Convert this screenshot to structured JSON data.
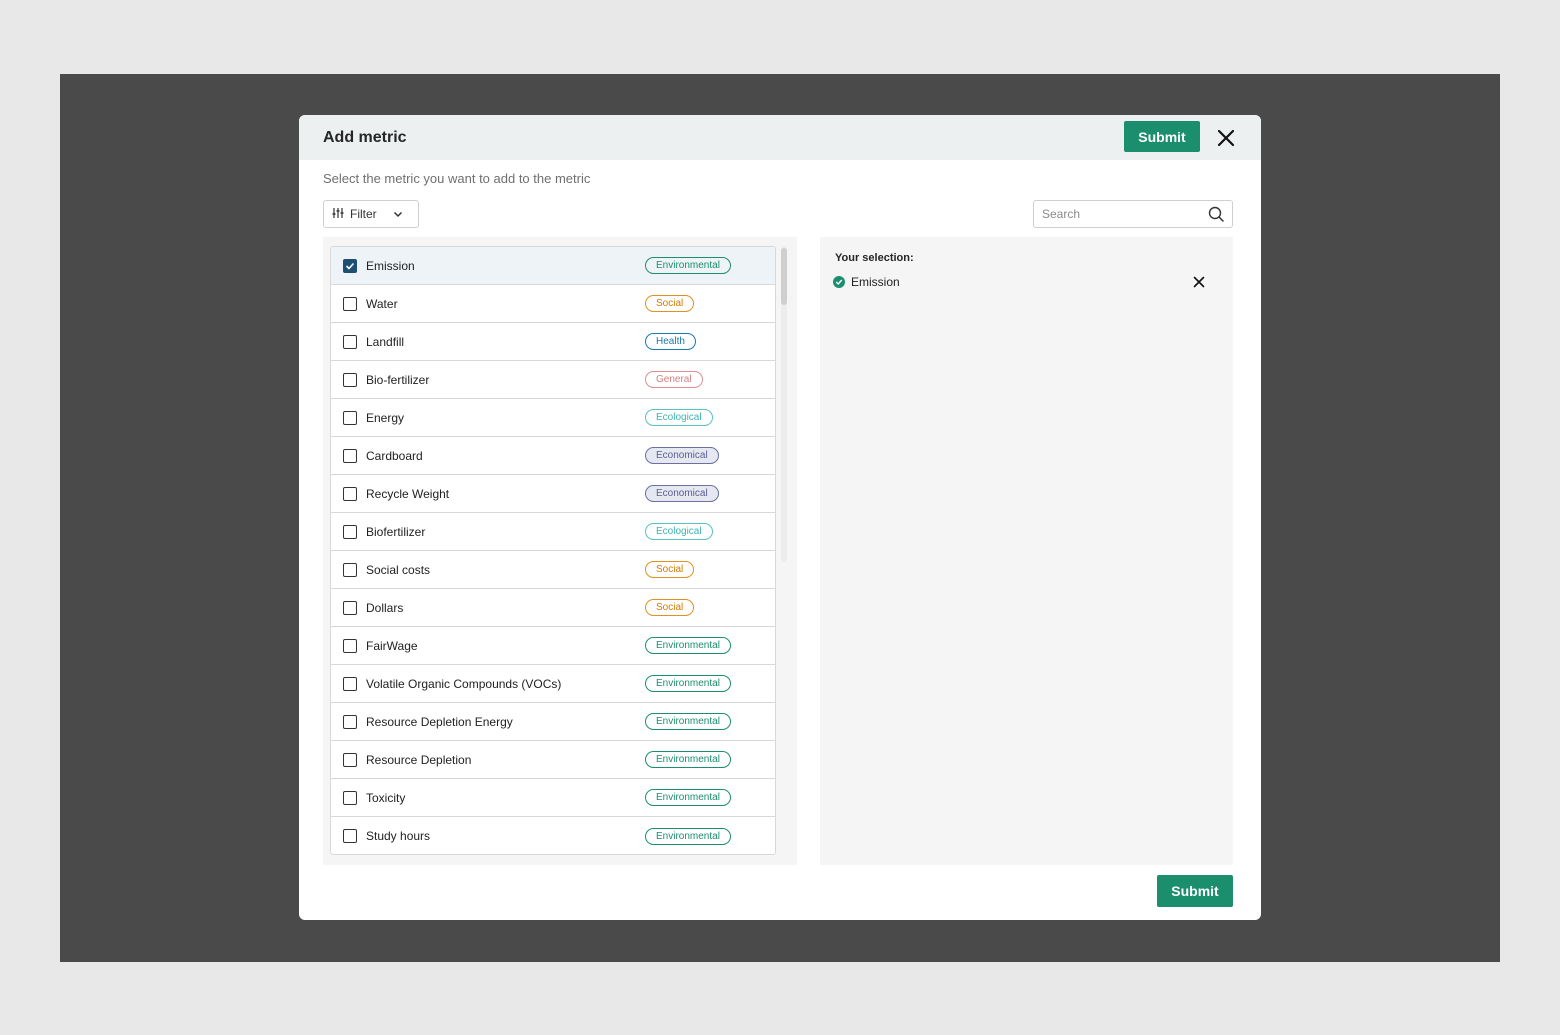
{
  "modal": {
    "title": "Add metric",
    "header_submit_label": "Submit",
    "subtitle": "Select the metric you want to add to the metric",
    "footer_submit_label": "Submit"
  },
  "filter": {
    "label": "Filter"
  },
  "search": {
    "placeholder": "Search",
    "value": ""
  },
  "metrics": [
    {
      "label": "Emission",
      "category": "Environmental",
      "checked": true
    },
    {
      "label": "Water",
      "category": "Social",
      "checked": false
    },
    {
      "label": "Landfill",
      "category": "Health",
      "checked": false
    },
    {
      "label": "Bio-fertilizer",
      "category": "General",
      "checked": false
    },
    {
      "label": "Energy",
      "category": "Ecological",
      "checked": false
    },
    {
      "label": "Cardboard",
      "category": "Economical",
      "checked": false
    },
    {
      "label": "Recycle Weight",
      "category": "Economical",
      "checked": false
    },
    {
      "label": "Biofertilizer",
      "category": "Ecological",
      "checked": false
    },
    {
      "label": "Social costs",
      "category": "Social",
      "checked": false
    },
    {
      "label": "Dollars",
      "category": "Social",
      "checked": false
    },
    {
      "label": "FairWage",
      "category": "Environmental",
      "checked": false
    },
    {
      "label": "Volatile Organic Compounds (VOCs)",
      "category": "Environmental",
      "checked": false
    },
    {
      "label": "Resource Depletion Energy",
      "category": "Environmental",
      "checked": false
    },
    {
      "label": "Resource Depletion",
      "category": "Environmental",
      "checked": false
    },
    {
      "label": "Toxicity",
      "category": "Environmental",
      "checked": false
    },
    {
      "label": "Study hours",
      "category": "Environmental",
      "checked": false
    }
  ],
  "selection": {
    "title": "Your selection:",
    "items": [
      {
        "label": "Emission"
      }
    ]
  },
  "colors": {
    "primary": "#1b8f6d",
    "checkbox_checked": "#1d4f73",
    "overlay": "#4a4a4a"
  }
}
